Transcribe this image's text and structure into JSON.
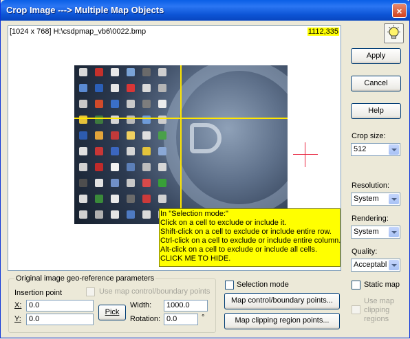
{
  "window": {
    "title": "Crop Image ---> Multiple Map Objects",
    "close_glyph": "×"
  },
  "image_info": {
    "path_label": "[1024 x 768] H:\\csdpmap_vb6\\0022.bmp",
    "cursor_coords": "1112,335"
  },
  "hint": {
    "lines": [
      "In \"Selection mode:\"",
      "Click on a cell to exclude or include it.",
      "Shift-click on a cell to exclude or include entire row.",
      "Ctrl-click on a cell to exclude or include entire column.",
      "Alt-click on a cell to exclude or include all cells.",
      "CLICK ME TO HIDE."
    ]
  },
  "sidebar": {
    "apply": "Apply",
    "cancel": "Cancel",
    "help": "Help",
    "crop_size_label": "Crop size:",
    "crop_size_value": "512",
    "resolution_label": "Resolution:",
    "resolution_value": "System",
    "rendering_label": "Rendering:",
    "rendering_value": "System",
    "quality_label": "Quality:",
    "quality_value": "Acceptabl",
    "static_map": "Static map",
    "use_map_clipping": [
      "Use map",
      "clipping",
      "regions"
    ]
  },
  "georef": {
    "group_title": "Original image geo-reference parameters",
    "insertion_point": "Insertion point",
    "use_map_control": "Use map control/boundary points",
    "x_label": "X:",
    "x_value": "0.0",
    "y_label": "Y:",
    "y_value": "0.0",
    "pick": "Pick",
    "width_label": "Width:",
    "width_value": "1000.0",
    "rotation_label": "Rotation:",
    "rotation_value": "0.0",
    "degree": "°"
  },
  "selection": {
    "selection_mode": "Selection mode",
    "control_points_button": "Map control/boundary points...",
    "clipping_points_button": "Map clipping region points..."
  },
  "colors": {
    "title_blue": "#0a5fe6",
    "coord_bg": "#ffff00",
    "grid_line": "#ffe600",
    "crosshair": "#e8203a"
  }
}
